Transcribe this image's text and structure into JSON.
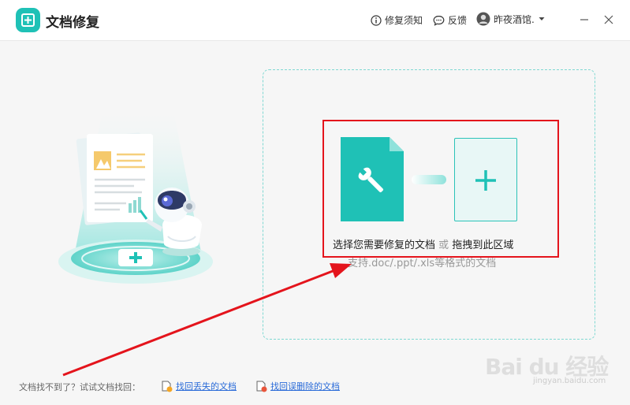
{
  "app": {
    "title": "文档修复",
    "accent": "#1fc1b6"
  },
  "header": {
    "notice_label": "修复须知",
    "feedback_label": "反馈",
    "user_name": "昨夜酒馆."
  },
  "dropzone": {
    "choose_text": "选择您需要修复的文档",
    "or_text": "或",
    "drag_text": "拖拽到此区域",
    "support_text": "支持.doc/.ppt/.xls等格式的文档"
  },
  "footer": {
    "hint": "文档找不到了？试试文档找回：",
    "link_lost": "找回丢失的文档",
    "link_deleted": "找回误删除的文档"
  },
  "watermark": {
    "brand": "Bai du 经验",
    "url": "jingyan.baidu.com"
  },
  "colors": {
    "teal": "#1fc1b6",
    "annotation_red": "#e4141c",
    "link_blue": "#2a6bd8"
  }
}
